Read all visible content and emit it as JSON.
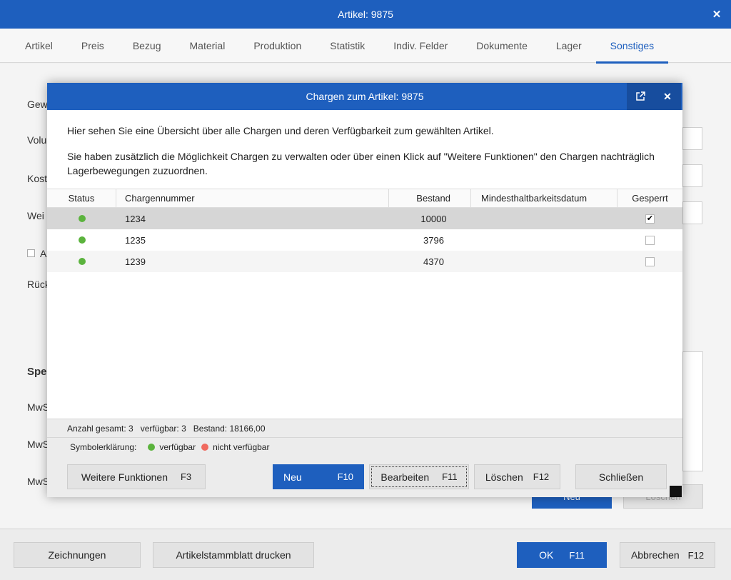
{
  "window": {
    "title": "Artikel: 9875",
    "close_glyph": "✕"
  },
  "tabs": [
    {
      "label": "Artikel"
    },
    {
      "label": "Preis"
    },
    {
      "label": "Bezug"
    },
    {
      "label": "Material"
    },
    {
      "label": "Produktion"
    },
    {
      "label": "Statistik"
    },
    {
      "label": "Indiv. Felder"
    },
    {
      "label": "Dokumente"
    },
    {
      "label": "Lager"
    },
    {
      "label": "Sonstiges",
      "active": true
    }
  ],
  "background": {
    "labels": [
      "Gew",
      "Volu",
      "Kost",
      "Wei",
      "A",
      "Rück",
      "Spe",
      "MwS",
      "MwS",
      "MwS"
    ],
    "neu_label": "Neu",
    "loeschen_label": "Löschen"
  },
  "footer": {
    "zeichnungen": "Zeichnungen",
    "stammblatt": "Artikelstammblatt drucken",
    "ok": "OK",
    "ok_key": "F11",
    "abbrechen": "Abbrechen",
    "abbrechen_key": "F12"
  },
  "dialog": {
    "title": "Chargen zum Artikel: 9875",
    "popout_icon": "↗",
    "close_glyph": "✕",
    "intro_1": "Hier sehen Sie eine Übersicht über alle Chargen und deren Verfügbarkeit zum gewählten Artikel.",
    "intro_2": "Sie haben zusätzlich die Möglichkeit Chargen zu verwalten oder über einen Klick auf \"Weitere Funktionen\" den Chargen nachträglich Lagerbewegungen zuzuordnen.",
    "columns": {
      "status": "Status",
      "chargennummer": "Chargennummer",
      "bestand": "Bestand",
      "mhd": "Mindesthaltbarkeitsdatum",
      "gesperrt": "Gesperrt"
    },
    "rows": [
      {
        "status": "verfügbar",
        "chargennummer": "1234",
        "bestand": "10000",
        "mhd": "",
        "gesperrt": true
      },
      {
        "status": "verfügbar",
        "chargennummer": "1235",
        "bestand": "3796",
        "mhd": "",
        "gesperrt": false
      },
      {
        "status": "verfügbar",
        "chargennummer": "1239",
        "bestand": "4370",
        "mhd": "",
        "gesperrt": false
      }
    ],
    "summary": "Anzahl gesamt: 3   verfügbar: 3   Bestand: 18166,00",
    "legend": {
      "label": "Symbolerklärung:",
      "available": "verfügbar",
      "unavailable": "nicht verfügbar",
      "available_color": "#5bb33d",
      "unavailable_color": "#f06a5f"
    },
    "buttons": {
      "weitere": "Weitere Funktionen",
      "weitere_key": "F3",
      "neu": "Neu",
      "neu_key": "F10",
      "bearbeiten": "Bearbeiten",
      "bearbeiten_key": "F11",
      "loeschen": "Löschen",
      "loeschen_key": "F12",
      "schliessen": "Schließen"
    },
    "checkmark": "✔"
  },
  "colors": {
    "accent": "#1e5fbe"
  }
}
